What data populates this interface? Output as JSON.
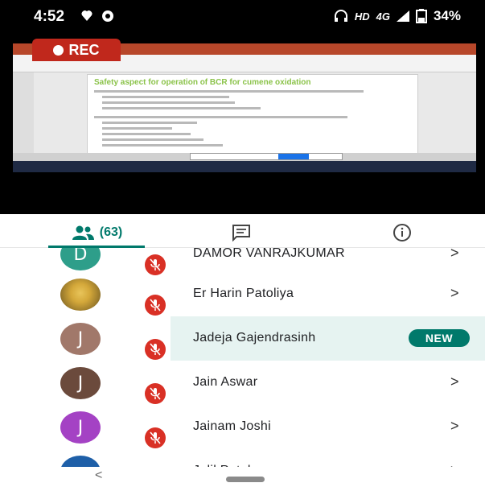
{
  "status_bar": {
    "time": "4:52",
    "network": "HD",
    "signal": "4G",
    "battery": "34%"
  },
  "recording": {
    "label": "REC"
  },
  "shared_slide": {
    "title": "Safety aspect for operation of BCR for cumene oxidation"
  },
  "tabs": {
    "people_count": "(63)",
    "people_icon": "people-icon",
    "chat_icon": "chat-icon",
    "info_icon": "info-icon",
    "accent": "#00796b"
  },
  "participants": [
    {
      "initial": "D",
      "name": "DAMOR VANRAJKUMAR",
      "avatar_color": "#2e9e8a",
      "photo": false,
      "muted": true,
      "badge": "",
      "chevron": ">"
    },
    {
      "initial": "",
      "name": "Er Harin Patoliya",
      "avatar_color": "#c8a24a",
      "photo": true,
      "muted": true,
      "badge": "",
      "chevron": ">"
    },
    {
      "initial": "J",
      "name": "Jadeja Gajendrasinh",
      "avatar_color": "#a1786a",
      "photo": false,
      "muted": true,
      "badge": "NEW",
      "chevron": ""
    },
    {
      "initial": "J",
      "name": "Jain Aswar",
      "avatar_color": "#6b4a3c",
      "photo": false,
      "muted": true,
      "badge": "",
      "chevron": ">"
    },
    {
      "initial": "J",
      "name": "Jainam Joshi",
      "avatar_color": "#a442c4",
      "photo": false,
      "muted": true,
      "badge": "",
      "chevron": ">"
    },
    {
      "initial": "",
      "name": "Jalil Patel",
      "avatar_color": "#1e5fa8",
      "photo": false,
      "muted": false,
      "badge": "",
      "chevron": ">"
    }
  ],
  "nav": {
    "back": "<"
  }
}
